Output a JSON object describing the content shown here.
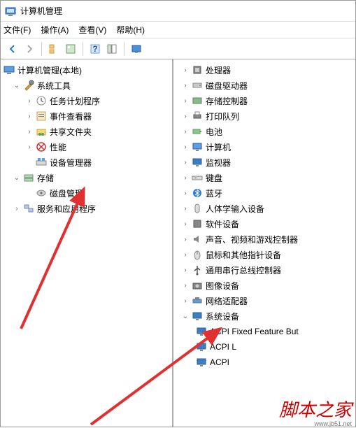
{
  "window": {
    "title": "计算机管理"
  },
  "menu": {
    "file": "文件(F)",
    "action": "操作(A)",
    "view": "查看(V)",
    "help": "帮助(H)"
  },
  "left_tree": {
    "root": "计算机管理(本地)",
    "system_tools": "系统工具",
    "task_scheduler": "任务计划程序",
    "event_viewer": "事件查看器",
    "shared_folders": "共享文件夹",
    "performance": "性能",
    "device_manager": "设备管理器",
    "storage": "存储",
    "disk_mgmt": "磁盘管理",
    "services_apps": "服务和应用程序"
  },
  "right_tree": {
    "processors": "处理器",
    "disk_drives": "磁盘驱动器",
    "storage_controllers": "存储控制器",
    "print_queues": "打印队列",
    "batteries": "电池",
    "computer": "计算机",
    "monitors": "监视器",
    "keyboards": "键盘",
    "bluetooth": "蓝牙",
    "hid": "人体学输入设备",
    "software_devices": "软件设备",
    "sound": "声音、视频和游戏控制器",
    "mice": "鼠标和其他指针设备",
    "usb": "通用串行总线控制器",
    "imaging": "图像设备",
    "network": "网络适配器",
    "system_devices": "系统设备",
    "acpi_fixed": "ACPI Fixed Feature But",
    "acpi_l": "ACPI L",
    "acpi": "ACPI"
  },
  "watermark": {
    "text": "脚本之家",
    "url": "www.jb51.net"
  }
}
